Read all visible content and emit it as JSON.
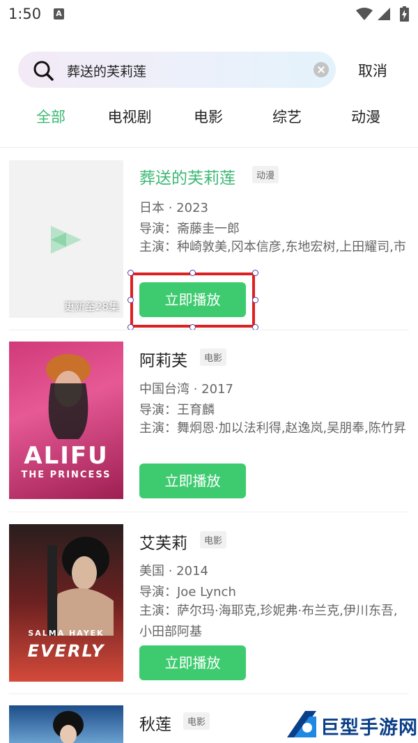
{
  "status": {
    "time": "1:50",
    "notif_icon": "A"
  },
  "search": {
    "query": "葬送的芙莉莲",
    "cancel": "取消"
  },
  "tabs": [
    "全部",
    "电视剧",
    "电影",
    "综艺",
    "动漫"
  ],
  "results": [
    {
      "title": "葬送的芙莉莲",
      "type": "动漫",
      "region_year": "日本 · 2023",
      "director": "导演：斋藤圭一郎",
      "cast": "主演：种崎敦美,冈本信彦,东地宏树,上田耀司,市之濑加那",
      "update": "更新至28集",
      "play": "立即播放"
    },
    {
      "title": "阿莉芙",
      "type": "电影",
      "region_year": "中国台湾 · 2017",
      "director": "导演：王育麟",
      "cast": "主演：舞炯恩·加以法利得,赵逸岚,吴朋奉,陈竹昇",
      "play": "立即播放",
      "poster_text": "ALIFU",
      "poster_sub": "THE PRINCESS"
    },
    {
      "title": "艾芙莉",
      "type": "电影",
      "region_year": "美国 · 2014",
      "director": "导演：Joe Lynch",
      "cast": "主演：萨尔玛·海耶克,珍妮弗·布兰克,伊川东吾,小田部阿基",
      "play": "立即播放",
      "poster_text": "EVERLY",
      "poster_sub": "SALMA HAYEK"
    },
    {
      "title": "秋莲",
      "type": "电影"
    }
  ],
  "watermark": "巨型手游网",
  "colors": {
    "accent": "#3bb873",
    "button": "#3ecb70",
    "highlight": "#dd2020"
  }
}
